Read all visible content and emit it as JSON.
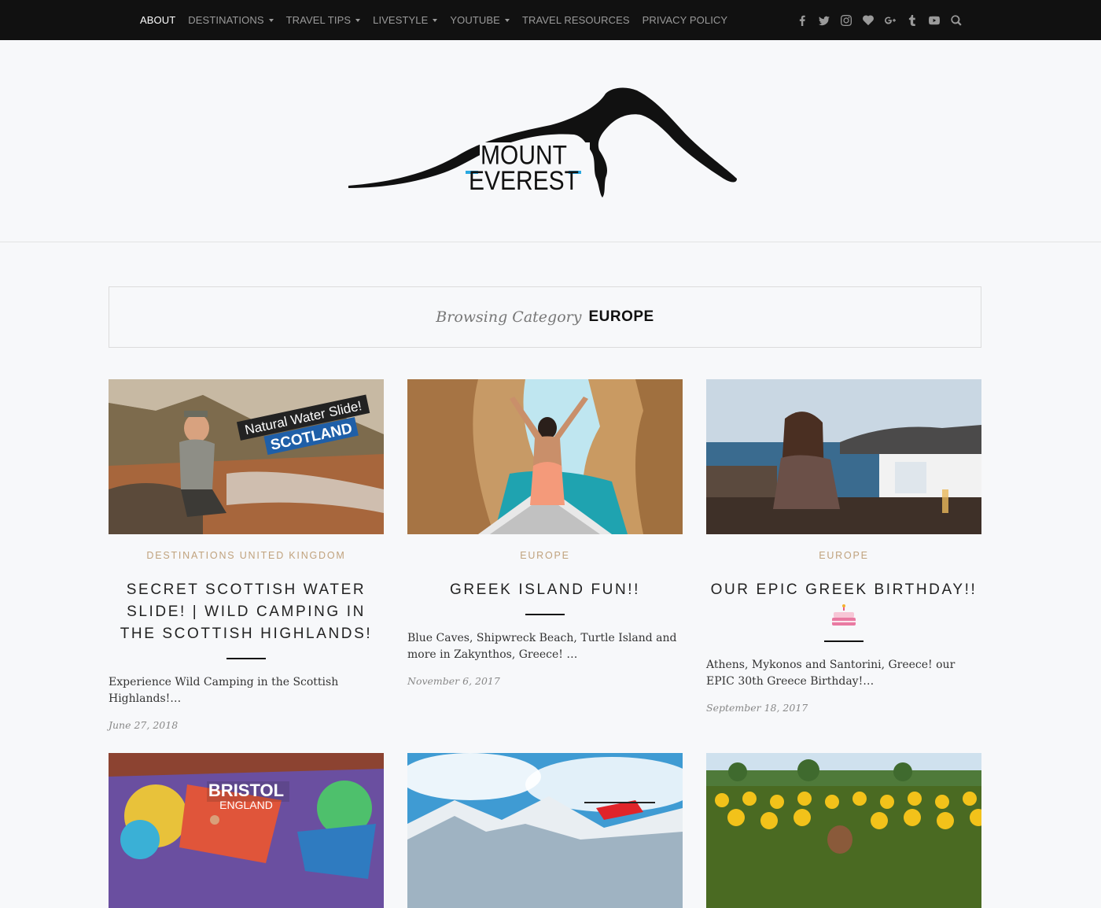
{
  "nav": {
    "items": [
      {
        "label": "ABOUT",
        "dropdown": false
      },
      {
        "label": "DESTINATIONS",
        "dropdown": true
      },
      {
        "label": "TRAVEL TIPS",
        "dropdown": true
      },
      {
        "label": "LIVESTYLE",
        "dropdown": true
      },
      {
        "label": "YOUTUBE",
        "dropdown": true
      },
      {
        "label": "TRAVEL RESOURCES",
        "dropdown": false
      },
      {
        "label": "PRIVACY POLICY",
        "dropdown": false
      }
    ],
    "social_icons": [
      "facebook-icon",
      "twitter-icon",
      "instagram-icon",
      "heart-icon",
      "google-plus-icon",
      "tumblr-icon",
      "youtube-icon",
      "search-icon"
    ]
  },
  "logo": {
    "line1": "MOUNT",
    "line2": "EVEREST",
    "accent": "#29a8e0"
  },
  "category": {
    "label": "Browsing Category",
    "name": "EUROPE"
  },
  "posts": [
    {
      "category": "DESTINATIONS UNITED KINGDOM",
      "title": "SECRET SCOTTISH WATER SLIDE! | WILD CAMPING IN THE SCOTTISH HIGHLANDS!",
      "excerpt": "Experience Wild Camping in the Scottish Highlands!…",
      "date": "June 27, 2018",
      "badge_top": "Natural Water Slide!",
      "badge_bottom": "SCOTLAND"
    },
    {
      "category": "EUROPE",
      "title": "GREEK ISLAND FUN!!",
      "excerpt": "Blue Caves, Shipwreck Beach, Turtle Island and more in Zakynthos, Greece! …",
      "date": "November 6, 2017"
    },
    {
      "category": "EUROPE",
      "title": "OUR EPIC GREEK BIRTHDAY!!",
      "excerpt": "Athens, Mykonos and Santorini, Greece! our EPIC 30th Greece Birthday!…",
      "date": "September 18, 2017"
    },
    {
      "overlay_title": "BRISTOL",
      "overlay_sub": "ENGLAND"
    },
    {},
    {}
  ],
  "colors": {
    "nav_bg": "#111111",
    "category_text": "#c0a27d",
    "page_bg": "#f7f8fa"
  }
}
